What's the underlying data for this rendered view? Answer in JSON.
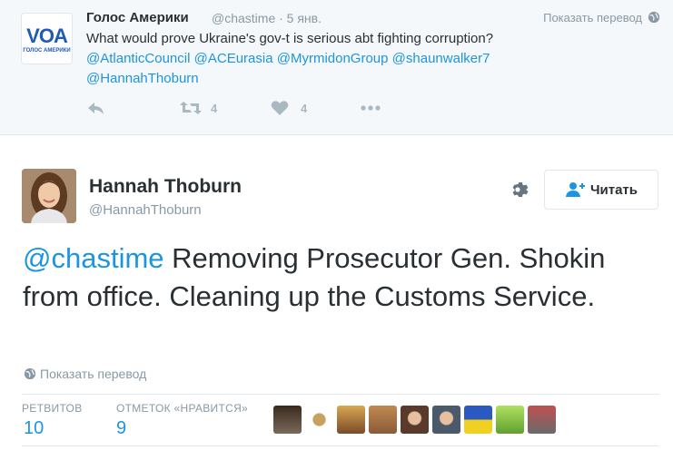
{
  "parent_tweet": {
    "author_name": "Голос Америки",
    "handle_date": "@chastime · 5 янв.",
    "translate": "Показать перевод",
    "text": "What would prove Ukraine's gov-t is serious abt fighting corruption?",
    "mentions": [
      "@AtlanticCouncil",
      "@ACEurasia",
      "@MyrmidonGroup",
      "@shaunwalker7",
      "@HannahThoburn"
    ],
    "retweets": "4",
    "likes": "4",
    "logo_text": "VOA",
    "logo_sub": "ГОЛОС АМЕРИКИ"
  },
  "main_tweet": {
    "author_name": "Hannah Thoburn",
    "handle": "@HannahThoburn",
    "follow_label": "Читать",
    "mention": "@chastime",
    "text": " Removing Prosecutor Gen. Shokin from office. Cleaning up the Customs Service.",
    "translate": "Показать перевод",
    "retweets_label": "РЕТВИТОВ",
    "retweets_count": "10",
    "likes_label": "ОТМЕТОК «НРАВИТСЯ»",
    "likes_count": "9"
  },
  "colors": {
    "link": "#1b95e0",
    "muted": "#8899a6",
    "text": "#292f33",
    "action": "#aab8c2"
  },
  "favoriters": [
    "#5a4a3a",
    "#7a5a3a",
    "#c9a25a",
    "#b07a4a",
    "#6a4a3a",
    "#4a5a6a",
    "#3060c0",
    "#8ac040",
    "#a04040"
  ]
}
